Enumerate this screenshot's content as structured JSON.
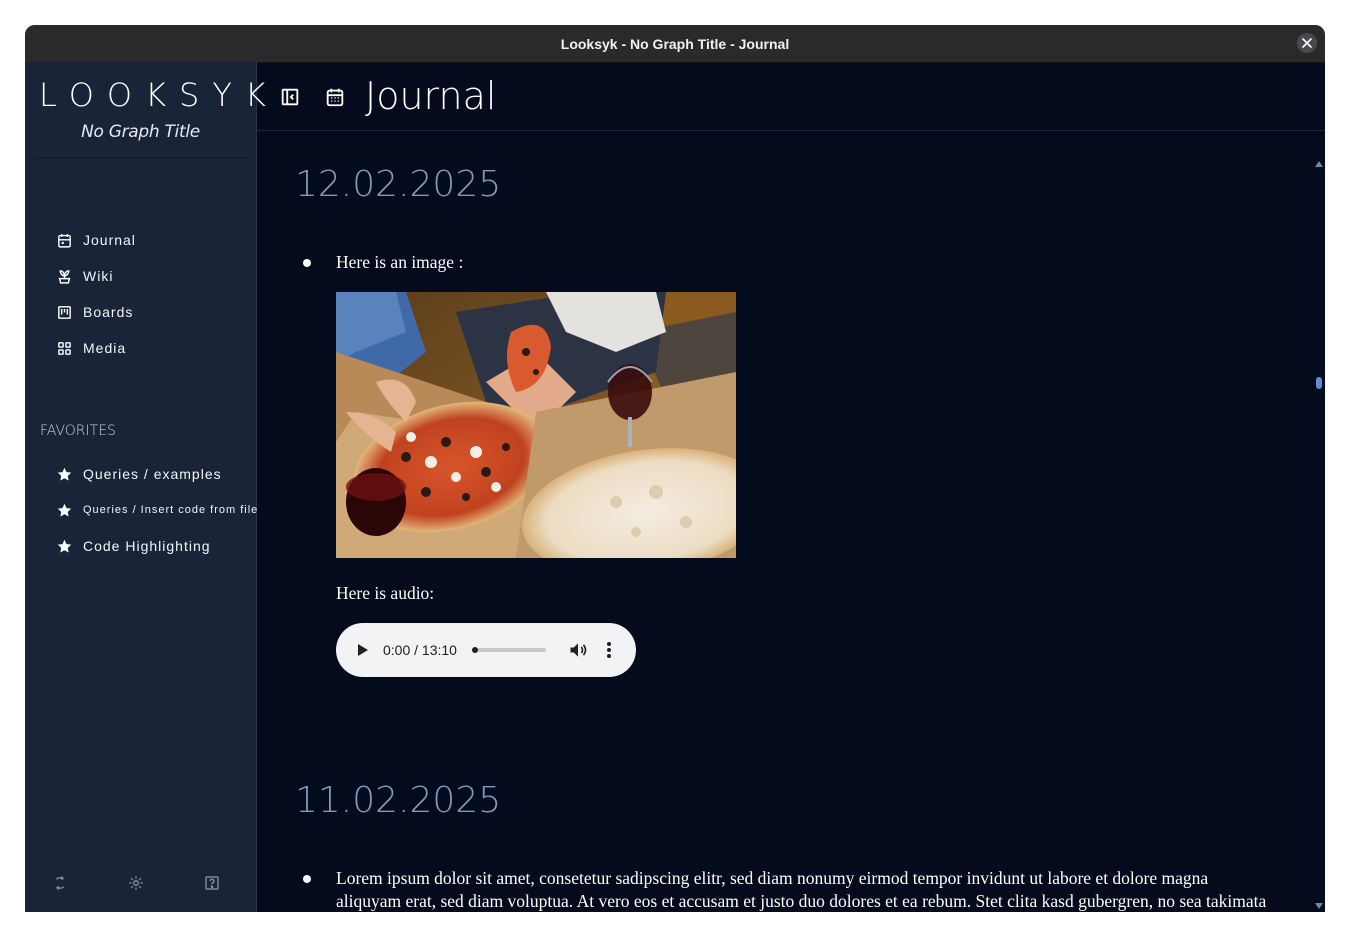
{
  "window": {
    "title": "Looksyk - No Graph Title - Journal"
  },
  "sidebar": {
    "brand": "LOOKSYK",
    "subtitle": "No Graph Title",
    "nav": [
      {
        "label": "Journal",
        "icon": "calendar-icon"
      },
      {
        "label": "Wiki",
        "icon": "plant-icon"
      },
      {
        "label": "Boards",
        "icon": "board-icon"
      },
      {
        "label": "Media",
        "icon": "grid-icon"
      }
    ],
    "favorites_heading": "FAVORITES",
    "favorites": [
      {
        "label": "Queries / examples",
        "icon": "star-icon"
      },
      {
        "label": "Queries / Insert code from file",
        "icon": "star-icon"
      },
      {
        "label": "Code Highlighting",
        "icon": "star-icon"
      }
    ],
    "bottom_icons": [
      "sync-icon",
      "gear-icon",
      "help-icon"
    ]
  },
  "header": {
    "title": "Journal",
    "icons": [
      "sidebar-toggle-icon",
      "calendar-icon"
    ]
  },
  "journal": {
    "entries": [
      {
        "date": "12.02.2025",
        "text1": "Here is an image :",
        "image": "pizza-photo",
        "text2": "Here is audio:",
        "audio": {
          "time": "0:00 / 13:10"
        }
      },
      {
        "date": "11.02.2025",
        "text1": "Lorem ipsum dolor sit amet, consetetur sadipscing elitr, sed diam nonumy eirmod tempor invidunt ut labore et dolore magna aliquyam erat, sed diam voluptua. At vero eos et accusam et justo duo dolores et ea rebum. Stet clita kasd gubergren, no sea takimata sanctus est"
      }
    ]
  },
  "colors": {
    "background": "#030b1d",
    "sidebar": "#1a2438",
    "date_heading": "#7f9bbd",
    "titlebar": "#2a2a2d"
  }
}
